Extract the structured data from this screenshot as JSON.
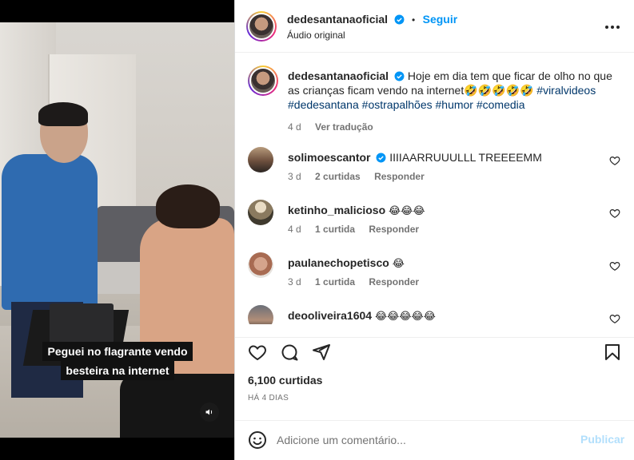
{
  "post": {
    "username": "dedesantanaoficial",
    "follow_label": "Seguir",
    "separator": "•",
    "audio": "Áudio original",
    "more_label": "•••",
    "verified_icon": "verified-badge-icon"
  },
  "video": {
    "caption_line1": "Peguei no flagrante vendo",
    "caption_line2": "besteira na internet",
    "mute_icon": "speaker-icon"
  },
  "caption": {
    "username": "dedesantanaoficial",
    "text": "Hoje em dia tem que ficar de olho no que as crianças ficam vendo na internet🤣🤣🤣🤣🤣",
    "hashtags": [
      "#viralvideos",
      "#dedesantana",
      "#ostrapalhões",
      "#humor",
      "#comedia"
    ],
    "time": "4 d",
    "translate_label": "Ver tradução"
  },
  "comments": [
    {
      "username": "solimoescantor",
      "verified": true,
      "text": "IIIIAARRUUULLL TREEEEMM",
      "time": "3 d",
      "likes": "2 curtidas",
      "reply_label": "Responder"
    },
    {
      "username": "ketinho_malicioso",
      "verified": false,
      "text": "😂😂😂",
      "time": "4 d",
      "likes": "1 curtida",
      "reply_label": "Responder"
    },
    {
      "username": "paulanechopetisco",
      "verified": false,
      "text": "😂",
      "time": "3 d",
      "likes": "1 curtida",
      "reply_label": "Responder"
    },
    {
      "username": "deooliveira1604",
      "verified": false,
      "text": "😂😂😂😂😂",
      "time": "",
      "likes": "",
      "reply_label": ""
    }
  ],
  "actions": {
    "like_icon": "heart-icon",
    "comment_icon": "comment-icon",
    "share_icon": "send-icon",
    "save_icon": "bookmark-icon"
  },
  "stats": {
    "likes": "6,100 curtidas",
    "date": "HÁ 4 DIAS"
  },
  "composer": {
    "placeholder": "Adicione um comentário...",
    "publish_label": "Publicar",
    "emoji_icon": "smiley-icon"
  },
  "colors": {
    "accent": "#0095f6",
    "hashtag": "#00376b",
    "muted": "#737373",
    "publish_disabled": "#b2dffc"
  }
}
